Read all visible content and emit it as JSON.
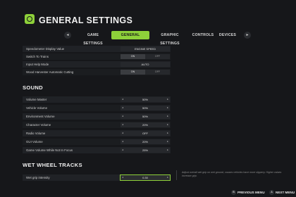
{
  "header": {
    "title": "GENERAL SETTINGS",
    "logo_icon": "farming-logo-icon"
  },
  "tabs": {
    "prev_icon": "chevron-left-icon",
    "next_icon": "chevron-right-icon",
    "prev_glyph": "◂",
    "next_glyph": "▸",
    "items": [
      {
        "label": "GAME SETTINGS"
      },
      {
        "label": "GENERAL SETTINGS"
      },
      {
        "label": "GRAPHIC SETTINGS"
      },
      {
        "label": "CONTROLS"
      },
      {
        "label": "DEVICES"
      }
    ],
    "active_index": 1
  },
  "general_rows": [
    {
      "label": "Speedometer Display Value",
      "value": "ENGINE SPEED",
      "type": "select"
    },
    {
      "label": "Switch To Trains",
      "on": "ON",
      "off": "OFF",
      "type": "toggle",
      "selected": "on"
    },
    {
      "label": "Input Help Mode",
      "value": "AUTO",
      "type": "select"
    },
    {
      "label": "Wood Harvester Automatic Cutting",
      "on": "ON",
      "off": "OFF",
      "type": "toggle",
      "selected": "on"
    }
  ],
  "sound": {
    "title": "SOUND",
    "rows": [
      {
        "label": "Volume Master",
        "value": "50%"
      },
      {
        "label": "Vehicle Volume",
        "value": "50%"
      },
      {
        "label": "Environment Volume",
        "value": "50%"
      },
      {
        "label": "Character Volume",
        "value": "20%"
      },
      {
        "label": "Radio Volume",
        "value": "OFF"
      },
      {
        "label": "GUI Volume",
        "value": "20%"
      },
      {
        "label": "Game Volume While Not In Focus",
        "value": "25%"
      }
    ]
  },
  "wet_wheel_tracks": {
    "title": "WET WHEEL TRACKS",
    "rows": [
      {
        "label": "Wet grip intensity",
        "value": "0.30"
      }
    ]
  },
  "arrows": {
    "left": "◂",
    "right": "▸"
  },
  "description": "Adjust overall wet grip on wet ground, causes vehicles have more slippery. Higher values increase grip.",
  "footer": {
    "previous_menu": "PREVIOUS MENU",
    "next_menu": "NEXT MENU",
    "previous_key": "B",
    "next_key": "A"
  },
  "colors": {
    "accent": "#8ed13a",
    "background": "#16171a",
    "row": "#202226"
  }
}
